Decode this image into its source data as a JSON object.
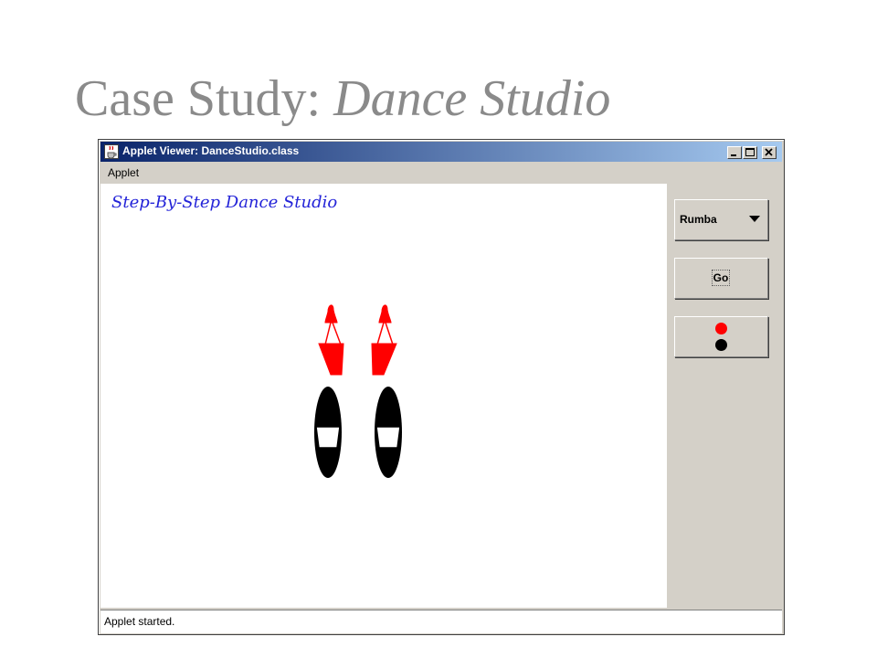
{
  "slide": {
    "title_prefix": "Case Study: ",
    "title_italic": "Dance Studio"
  },
  "window": {
    "title": "Applet Viewer: DanceStudio.class",
    "menu": [
      "Applet"
    ]
  },
  "canvas": {
    "heading": "Step-By-Step Dance Studio"
  },
  "controls": {
    "dance_selected": "Rumba",
    "go_label": "Go",
    "color_indicator": [
      "#ff0000",
      "#000000"
    ]
  },
  "status": {
    "text": "Applet started."
  },
  "colors": {
    "title_gray": "#8a8a8a",
    "heading_blue": "#2323d8",
    "woman_feet": "#ff0000",
    "man_feet": "#000000",
    "titlebar_start": "#0a246a",
    "titlebar_end": "#a6caf0"
  }
}
